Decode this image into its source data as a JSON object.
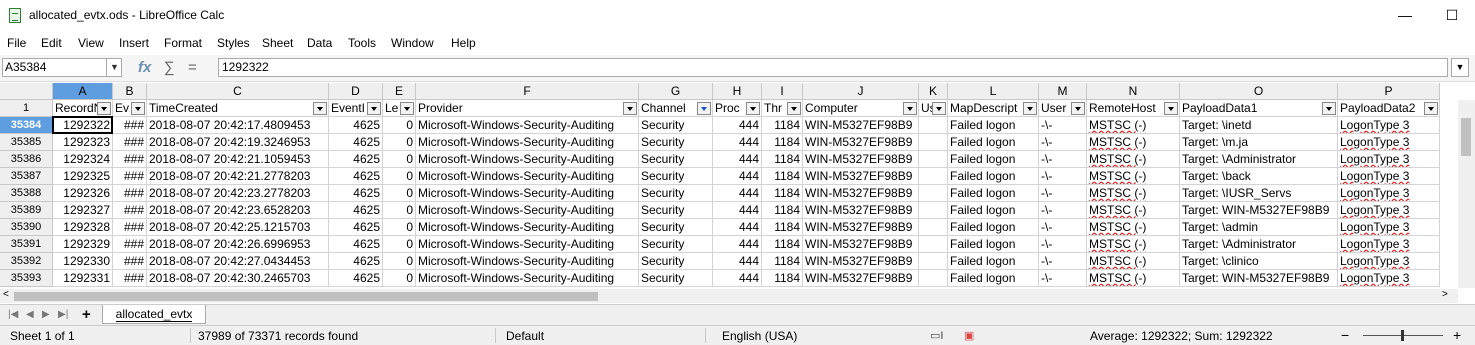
{
  "window": {
    "title": "allocated_evtx.ods - LibreOffice Calc",
    "minimize_glyph": "—",
    "maximize_glyph": "☐"
  },
  "menu": [
    "File",
    "Edit",
    "View",
    "Insert",
    "Format",
    "Styles",
    "Sheet",
    "Data",
    "Tools",
    "Window",
    "Help"
  ],
  "formula_bar": {
    "name_box": "A35384",
    "fx_glyph": "fx",
    "sum_glyph": "∑",
    "equals_glyph": "=",
    "value": "1292322"
  },
  "columns": [
    "A",
    "B",
    "C",
    "D",
    "E",
    "F",
    "G",
    "H",
    "I",
    "J",
    "K",
    "L",
    "M",
    "N",
    "O",
    "P"
  ],
  "header_row": {
    "row_number": "1",
    "cells": [
      "RecordN",
      "Ev",
      "TimeCreated",
      "EventI",
      "Le",
      "Provider",
      "Channel",
      "Proc",
      "Thr",
      "Computer",
      "Us",
      "MapDescript",
      "User",
      "RemoteHost",
      "PayloadData1",
      "PayloadData2"
    ]
  },
  "rows": [
    {
      "row": "35384",
      "cells": [
        "1292322",
        "###",
        "2018-08-07 20:42:17.4809453",
        "4625",
        "0",
        "Microsoft-Windows-Security-Auditing",
        "Security",
        "444",
        "1184",
        "WIN-M5327EF98B9",
        "",
        "Failed logon",
        "-\\-",
        "MSTSC (-)",
        "Target: \\inetd",
        "LogonType 3"
      ]
    },
    {
      "row": "35385",
      "cells": [
        "1292323",
        "###",
        "2018-08-07 20:42:19.3246953",
        "4625",
        "0",
        "Microsoft-Windows-Security-Auditing",
        "Security",
        "444",
        "1184",
        "WIN-M5327EF98B9",
        "",
        "Failed logon",
        "-\\-",
        "MSTSC (-)",
        "Target: \\m.ja",
        "LogonType 3"
      ]
    },
    {
      "row": "35386",
      "cells": [
        "1292324",
        "###",
        "2018-08-07 20:42:21.1059453",
        "4625",
        "0",
        "Microsoft-Windows-Security-Auditing",
        "Security",
        "444",
        "1184",
        "WIN-M5327EF98B9",
        "",
        "Failed logon",
        "-\\-",
        "MSTSC (-)",
        "Target: \\Administrator",
        "LogonType 3"
      ]
    },
    {
      "row": "35387",
      "cells": [
        "1292325",
        "###",
        "2018-08-07 20:42:21.2778203",
        "4625",
        "0",
        "Microsoft-Windows-Security-Auditing",
        "Security",
        "444",
        "1184",
        "WIN-M5327EF98B9",
        "",
        "Failed logon",
        "-\\-",
        "MSTSC (-)",
        "Target: \\back",
        "LogonType 3"
      ]
    },
    {
      "row": "35388",
      "cells": [
        "1292326",
        "###",
        "2018-08-07 20:42:23.2778203",
        "4625",
        "0",
        "Microsoft-Windows-Security-Auditing",
        "Security",
        "444",
        "1184",
        "WIN-M5327EF98B9",
        "",
        "Failed logon",
        "-\\-",
        "MSTSC (-)",
        "Target: \\IUSR_Servs",
        "LogonType 3"
      ]
    },
    {
      "row": "35389",
      "cells": [
        "1292327",
        "###",
        "2018-08-07 20:42:23.6528203",
        "4625",
        "0",
        "Microsoft-Windows-Security-Auditing",
        "Security",
        "444",
        "1184",
        "WIN-M5327EF98B9",
        "",
        "Failed logon",
        "-\\-",
        "MSTSC (-)",
        "Target: WIN-M5327EF98B9",
        "LogonType 3"
      ]
    },
    {
      "row": "35390",
      "cells": [
        "1292328",
        "###",
        "2018-08-07 20:42:25.1215703",
        "4625",
        "0",
        "Microsoft-Windows-Security-Auditing",
        "Security",
        "444",
        "1184",
        "WIN-M5327EF98B9",
        "",
        "Failed logon",
        "-\\-",
        "MSTSC (-)",
        "Target: \\admin",
        "LogonType 3"
      ]
    },
    {
      "row": "35391",
      "cells": [
        "1292329",
        "###",
        "2018-08-07 20:42:26.6996953",
        "4625",
        "0",
        "Microsoft-Windows-Security-Auditing",
        "Security",
        "444",
        "1184",
        "WIN-M5327EF98B9",
        "",
        "Failed logon",
        "-\\-",
        "MSTSC (-)",
        "Target: \\Administrator",
        "LogonType 3"
      ]
    },
    {
      "row": "35392",
      "cells": [
        "1292330",
        "###",
        "2018-08-07 20:42:27.0434453",
        "4625",
        "0",
        "Microsoft-Windows-Security-Auditing",
        "Security",
        "444",
        "1184",
        "WIN-M5327EF98B9",
        "",
        "Failed logon",
        "-\\-",
        "MSTSC (-)",
        "Target: \\clinico",
        "LogonType 3"
      ]
    },
    {
      "row": "35393",
      "cells": [
        "1292331",
        "###",
        "2018-08-07 20:42:30.2465703",
        "4625",
        "0",
        "Microsoft-Windows-Security-Auditing",
        "Security",
        "444",
        "1184",
        "WIN-M5327EF98B9",
        "",
        "Failed logon",
        "-\\-",
        "MSTSC (-)",
        "Target: WIN-M5327EF98B9",
        "LogonType 3"
      ]
    }
  ],
  "sheet_tabs": [
    "allocated_evtx"
  ],
  "status_bar": {
    "sheet": "Sheet 1 of 1",
    "records": "37989 of 73371 records found",
    "style": "Default",
    "language": "English (USA)",
    "summary": "Average: 1292322; Sum: 1292322"
  }
}
